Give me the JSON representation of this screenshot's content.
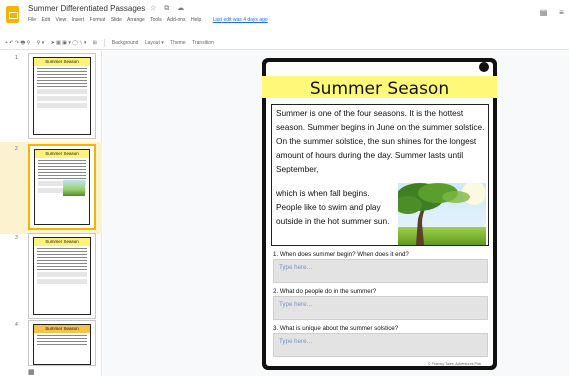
{
  "window": {
    "title": "Summer Differentiated Passages",
    "title_icons": "☆ ⧉ ☁",
    "menu": [
      "File",
      "Edit",
      "View",
      "Insert",
      "Format",
      "Slide",
      "Arrange",
      "Tools",
      "Add-ons",
      "Help"
    ],
    "last_edit": "Last edit was 4 days ago"
  },
  "toolbar": {
    "undo_group": "+ ↶ ↷ 🖶 ⚲",
    "zoom": "⚲ ▾",
    "tools": "➤ ▦ ▣ ▾ ◯ ∖ ▾",
    "comment": "⊞",
    "background": "Background",
    "layout": "Layout ▾",
    "theme": "Theme",
    "transition": "Transition"
  },
  "filmstrip": {
    "slides": [
      {
        "num": "1",
        "title": "Summer Season"
      },
      {
        "num": "2",
        "title": "Summer Season"
      },
      {
        "num": "3",
        "title": "Summer Season"
      },
      {
        "num": "4",
        "title": "Summer Season"
      }
    ],
    "bottom_icons": [
      "▦",
      "▤"
    ]
  },
  "slide": {
    "title": "Summer Season",
    "passage_wide": "Summer is one of the four seasons. It is the hottest season. Summer begins in June on the summer solstice. On the summer solstice, the sun shines for the longest amount of hours during the day. Summer lasts until September,",
    "passage_narrow": "which is when fall begins. People like to swim and play outside in the hot summer sun.",
    "questions": [
      {
        "label": "1. When does summer begin? When does it end?",
        "placeholder": "Type here…"
      },
      {
        "label": "2. What do people do in the summer?",
        "placeholder": "Type here…"
      },
      {
        "label": "3. What is unique about the summer solstice?",
        "placeholder": "Type here…"
      }
    ],
    "copyright": "© Fluency Tales, Adventures Pick"
  },
  "colors": {
    "banner": "#fff97a",
    "app_accent": "#f4b400",
    "selected_strip": "#fdf2d0"
  }
}
